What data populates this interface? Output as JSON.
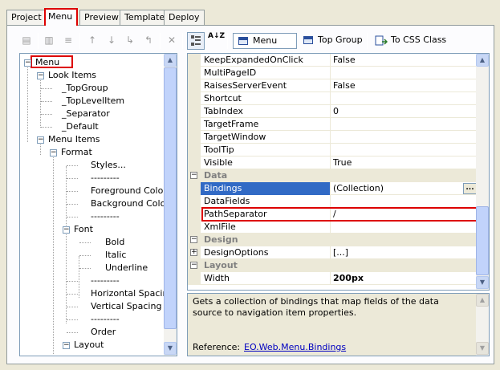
{
  "tabs": [
    {
      "label": "Project",
      "active": false
    },
    {
      "label": "Menu",
      "active": true
    },
    {
      "label": "Preview",
      "active": false
    },
    {
      "label": "Template",
      "active": false
    },
    {
      "label": "Deploy",
      "active": false
    }
  ],
  "toolbar": {
    "combo_value": "Menu",
    "top_group_label": "Top Group",
    "to_css_label": "To CSS Class",
    "sort_icon_text": "A↓Z"
  },
  "tree": {
    "root": "Menu",
    "look_items": "Look Items",
    "top_group": "_TopGroup",
    "top_level_item": "_TopLevelItem",
    "separator": "_Separator",
    "default": "_Default",
    "menu_items": "Menu Items",
    "format": "Format",
    "styles": "Styles...",
    "dash1": "---------",
    "foreground_color": "Foreground Color...",
    "background_color": "Background Color...",
    "dash2": "---------",
    "font": "Font",
    "bold": "Bold",
    "italic": "Italic",
    "underline": "Underline",
    "dash3": "---------",
    "horizontal_spacing": "Horizontal Spacing",
    "vertical_spacing": "Vertical Spacing",
    "dash4": "---------",
    "order": "Order",
    "layout": "Layout"
  },
  "properties": [
    {
      "name": "KeepExpandedOnClick",
      "value": "False"
    },
    {
      "name": "MultiPageID",
      "value": ""
    },
    {
      "name": "RaisesServerEvent",
      "value": "False"
    },
    {
      "name": "Shortcut",
      "value": ""
    },
    {
      "name": "TabIndex",
      "value": "0"
    },
    {
      "name": "TargetFrame",
      "value": ""
    },
    {
      "name": "TargetWindow",
      "value": ""
    },
    {
      "name": "ToolTip",
      "value": ""
    },
    {
      "name": "Visible",
      "value": "True"
    },
    {
      "category": "Data"
    },
    {
      "name": "Bindings",
      "value": "(Collection)"
    },
    {
      "name": "DataFields",
      "value": ""
    },
    {
      "name": "PathSeparator",
      "value": "/"
    },
    {
      "name": "XmlFile",
      "value": ""
    },
    {
      "category": "Design"
    },
    {
      "name": "DesignOptions",
      "value": "[...]"
    },
    {
      "category": "Layout"
    },
    {
      "name": "Width",
      "value": "200px"
    }
  ],
  "grid_labels": {
    "ellipsis": "...",
    "collapse": "−",
    "expand": "+"
  },
  "description": {
    "text": "Gets a collection of bindings that map fields of the data source to navigation item properties.",
    "reference_label": "Reference:",
    "reference_link": "EO.Web.Menu.Bindings"
  },
  "colors": {
    "selection": "#316ac5",
    "highlight_border": "#dd0000",
    "window_bg": "#ece9d8"
  }
}
